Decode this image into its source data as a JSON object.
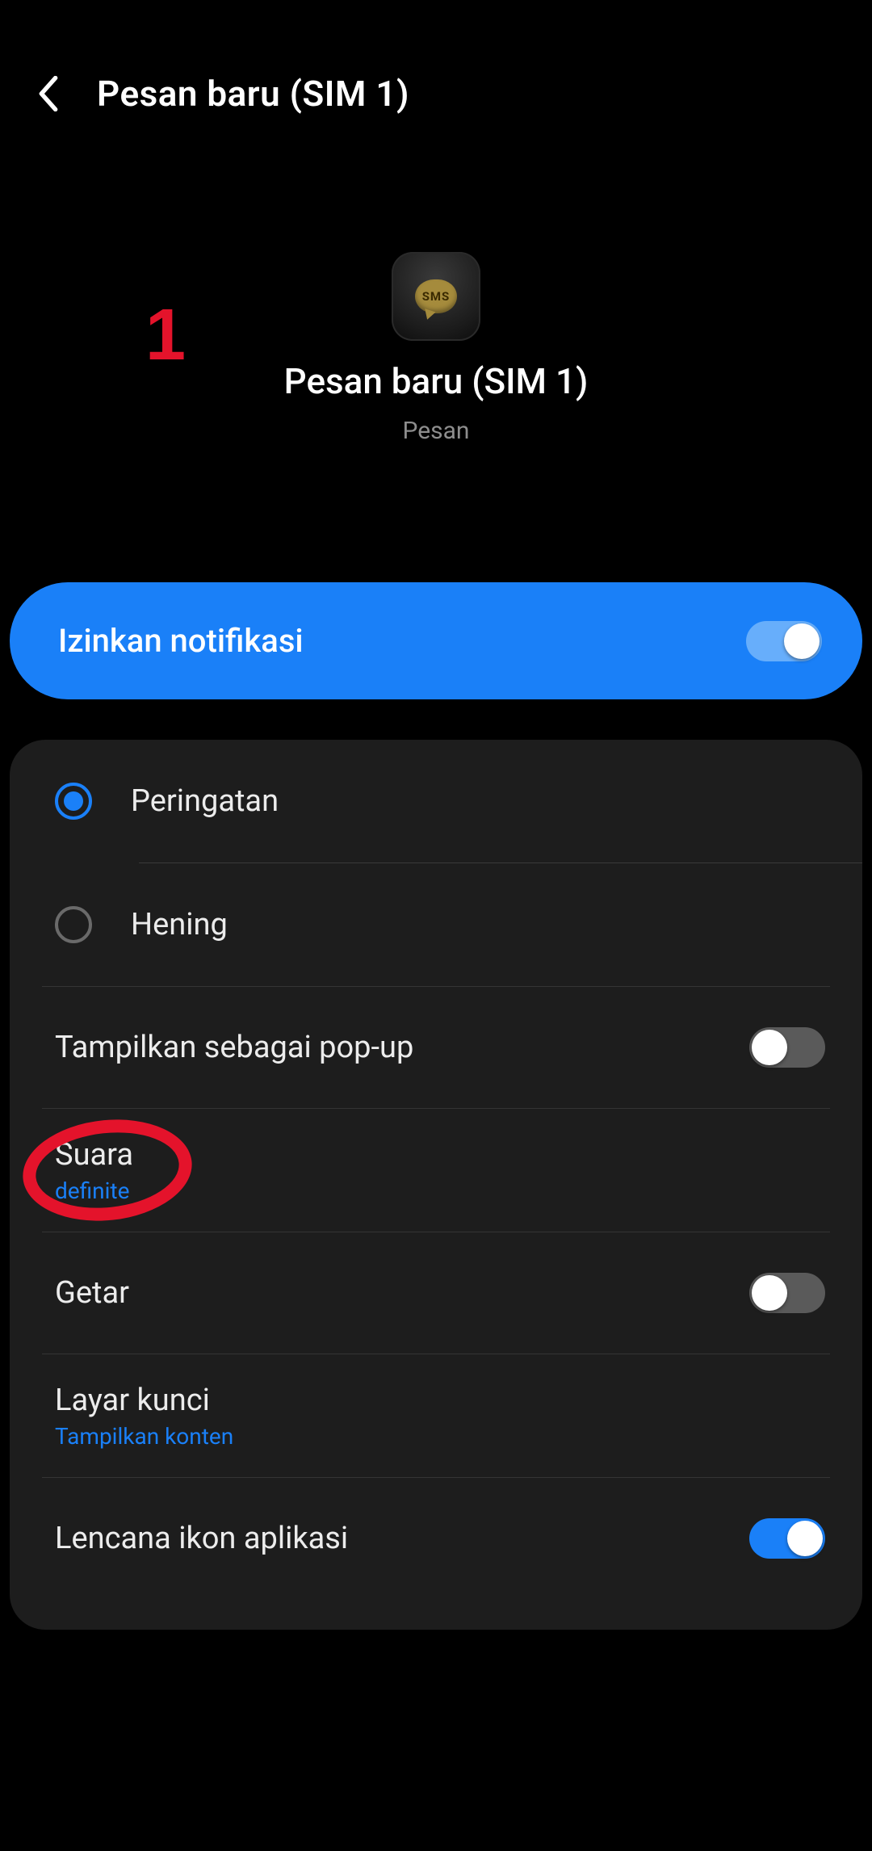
{
  "header": {
    "title": "Pesan baru (SIM 1)"
  },
  "app": {
    "icon_text": "SMS",
    "title": "Pesan baru (SIM 1)",
    "subtitle": "Pesan"
  },
  "annotation": {
    "number": "1"
  },
  "allow": {
    "label": "Izinkan notifikasi",
    "on": true
  },
  "alert_style": {
    "items": [
      {
        "label": "Peringatan",
        "selected": true
      },
      {
        "label": "Hening",
        "selected": false
      }
    ]
  },
  "settings": {
    "popup": {
      "label": "Tampilkan sebagai pop-up",
      "on": false
    },
    "sound": {
      "label": "Suara",
      "value": "definite"
    },
    "vibrate": {
      "label": "Getar",
      "on": false
    },
    "lockscreen": {
      "label": "Layar kunci",
      "value": "Tampilkan konten"
    },
    "badge": {
      "label": "Lencana ikon aplikasi",
      "on": true
    }
  }
}
